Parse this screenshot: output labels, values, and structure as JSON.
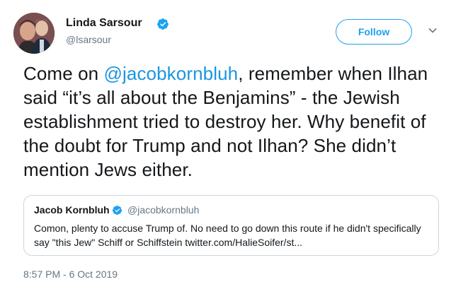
{
  "author": {
    "name": "Linda Sarsour",
    "handle": "@lsarsour"
  },
  "follow_button": {
    "label": "Follow"
  },
  "tweet": {
    "text_before_mention": "Come on ",
    "mention": "@jacobkornbluh",
    "text_after_mention": ", remember when Ilhan said “it’s all about the Benjamins” - the Jewish establishment tried to destroy her. Why benefit of the doubt for Trump and not Ilhan? She didn’t mention Jews either.",
    "timestamp": "8:57 PM - 6 Oct 2019"
  },
  "quoted_tweet": {
    "name": "Jacob Kornbluh",
    "handle": "@jacobkornbluh",
    "text": "Comon, plenty to accuse Trump of. No need to go down this route if he didn't specifically say \"this Jew\" Schiff or Schiffstein twitter.com/HalieSoifer/st..."
  },
  "colors": {
    "accent": "#1da1f2",
    "mention": "#1b95e0",
    "secondary_text": "#657786",
    "border": "#ccd6dd"
  },
  "icons": {
    "verified": "verified-badge-icon",
    "caret": "chevron-down-icon"
  }
}
